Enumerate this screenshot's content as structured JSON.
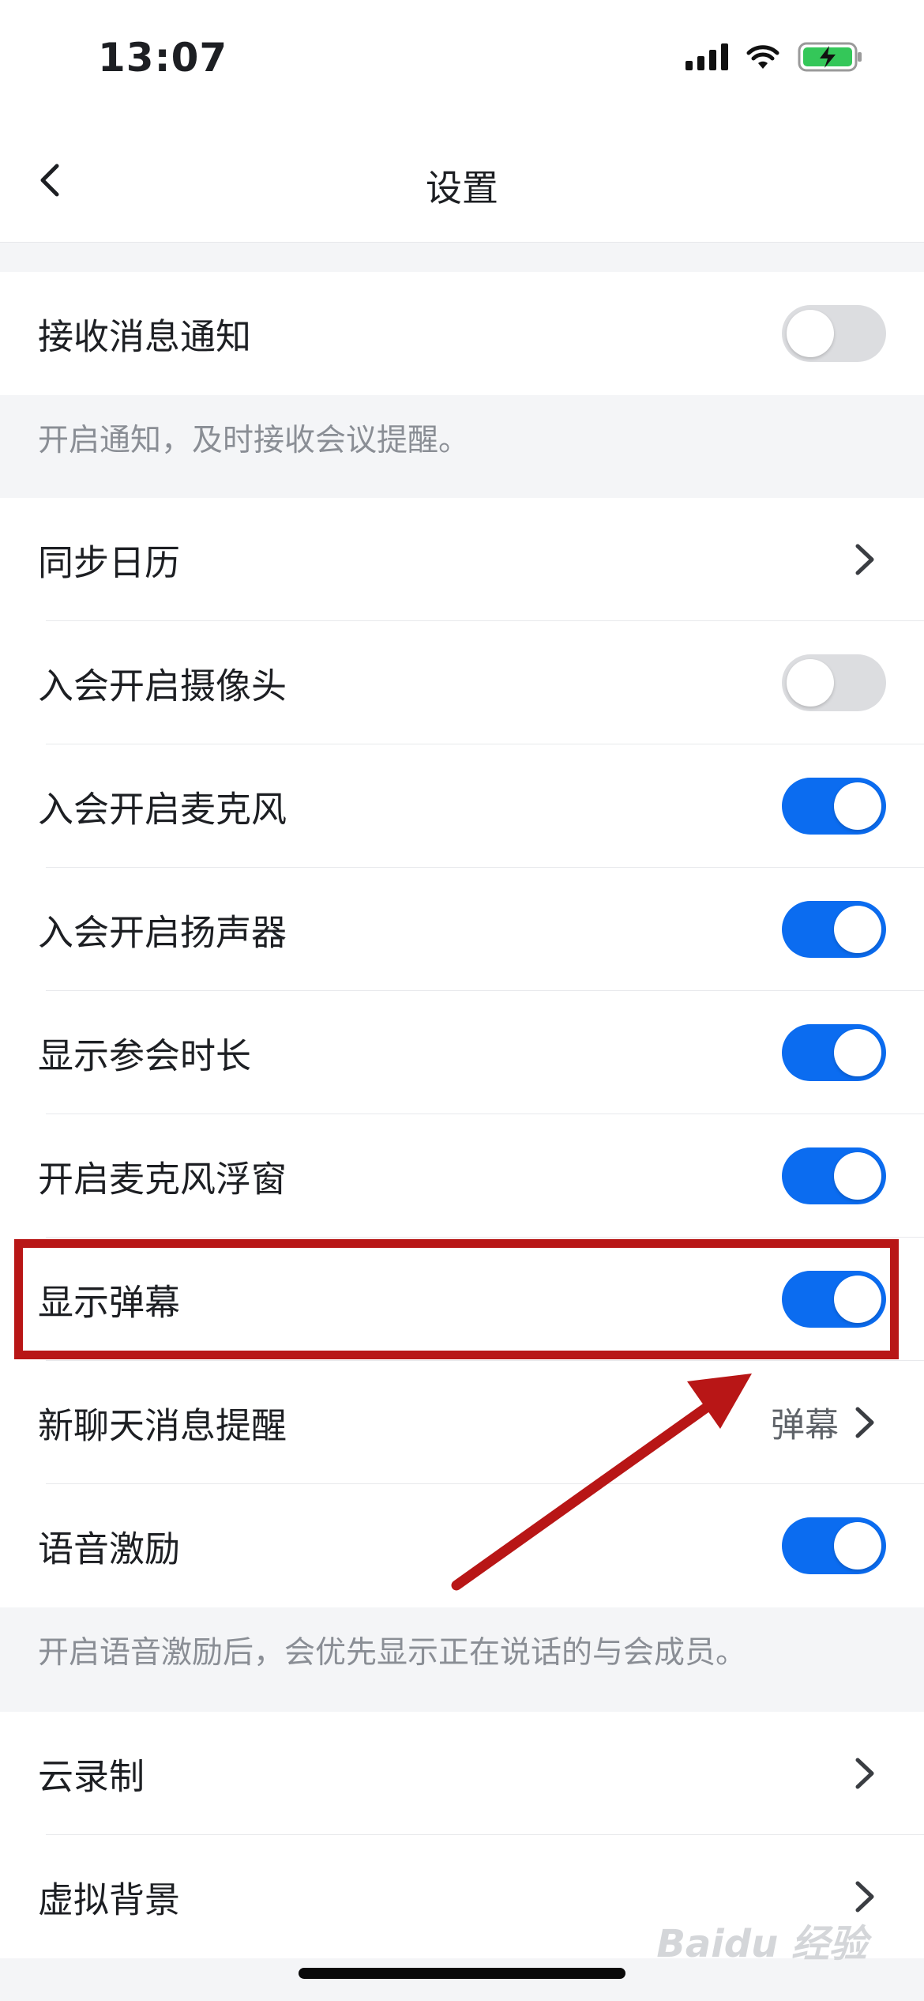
{
  "status_bar": {
    "time": "13:07",
    "icons": [
      "signal-icon",
      "wifi-icon",
      "battery-charging-icon"
    ]
  },
  "nav": {
    "title": "设置",
    "back_icon": "chevron-left-icon"
  },
  "sections": [
    {
      "rows": [
        {
          "label": "接收消息通知",
          "type": "toggle",
          "on": false
        }
      ],
      "hint": "开启通知，及时接收会议提醒。"
    },
    {
      "rows": [
        {
          "label": "同步日历",
          "type": "link"
        },
        {
          "label": "入会开启摄像头",
          "type": "toggle",
          "on": false
        },
        {
          "label": "入会开启麦克风",
          "type": "toggle",
          "on": true
        },
        {
          "label": "入会开启扬声器",
          "type": "toggle",
          "on": true
        },
        {
          "label": "显示参会时长",
          "type": "toggle",
          "on": true
        },
        {
          "label": "开启麦克风浮窗",
          "type": "toggle",
          "on": true
        },
        {
          "label": "显示弹幕",
          "type": "toggle",
          "on": true
        },
        {
          "label": "新聊天消息提醒",
          "type": "link",
          "value": "弹幕"
        },
        {
          "label": "语音激励",
          "type": "toggle",
          "on": true
        }
      ],
      "hint": "开启语音激励后，会优先显示正在说话的与会成员。"
    },
    {
      "rows": [
        {
          "label": "云录制",
          "type": "link"
        },
        {
          "label": "虚拟背景",
          "type": "link"
        }
      ]
    }
  ],
  "annotation": {
    "color": "#b81616",
    "highlighted_row": "显示弹幕"
  },
  "colors": {
    "toggle_on": "#0b6cf0",
    "toggle_off": "#dcdde0",
    "background": "#f4f5f7"
  },
  "watermark": "Baidu 经验"
}
